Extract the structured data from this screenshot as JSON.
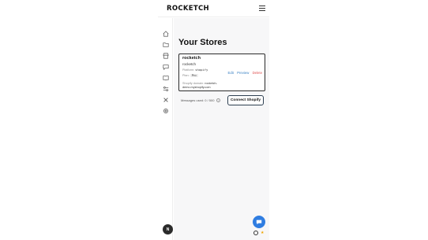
{
  "header": {
    "logo": "ROCKETCH",
    "menu_icon": "hamburger-icon"
  },
  "sidebar": {
    "items": [
      {
        "icon": "home-icon"
      },
      {
        "icon": "folder-icon"
      },
      {
        "icon": "store-icon"
      },
      {
        "icon": "chat-bubble-icon"
      },
      {
        "icon": "book-icon"
      },
      {
        "icon": "sliders-icon"
      },
      {
        "icon": "tools-icon"
      },
      {
        "icon": "gear-icon"
      }
    ],
    "avatar_initial": "N"
  },
  "main": {
    "title": "Your Stores",
    "store": {
      "name": "rocketch",
      "subtitle": "rocketch",
      "platform_label": "Platform:",
      "platform_value": "shopify",
      "plan_label": "Plan:",
      "plan_value": "Pro",
      "domain_label": "Shopify domain:",
      "domain_value": "rocketch-demo.myshopify.com",
      "actions": {
        "edit": "Edit",
        "preview": "Preview",
        "delete": "Delete"
      }
    },
    "usage_text": "Messages used: 0 / 500",
    "connect_label": "Connect Shopify"
  },
  "colors": {
    "accent": "#2f7de1",
    "delete": "#e05252",
    "link": "#3b82c4"
  }
}
